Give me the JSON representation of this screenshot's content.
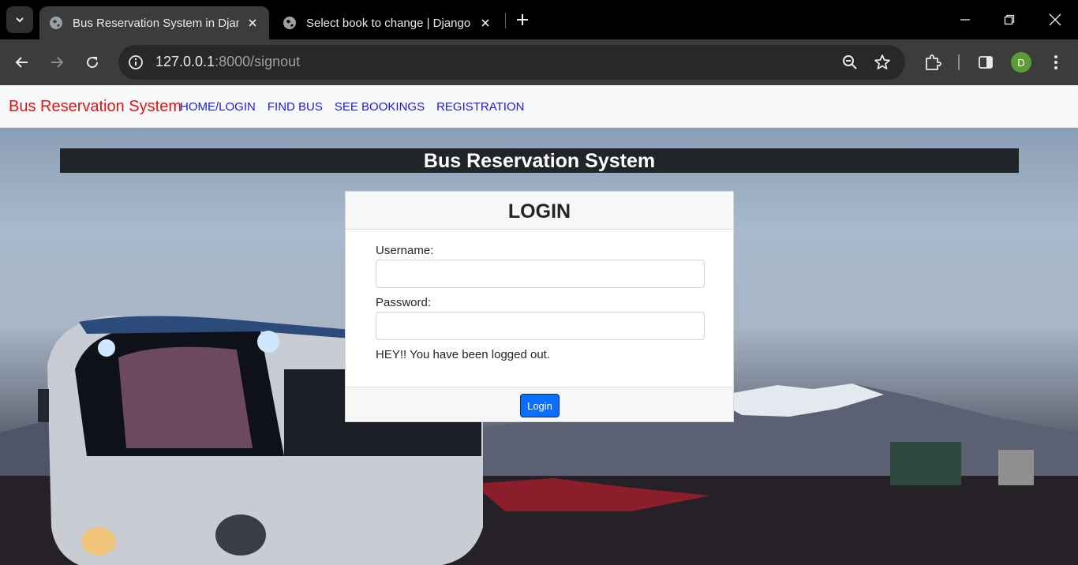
{
  "browser": {
    "tabs": [
      {
        "title": "Bus Reservation System in Djang",
        "active": true
      },
      {
        "title": "Select book to change | Django",
        "active": false
      }
    ],
    "address": {
      "host": "127.0.0.1",
      "rest": ":8000/signout"
    },
    "profile_initial": "D"
  },
  "navbar": {
    "brand": "Bus Reservation System",
    "links": [
      "HOME/LOGIN",
      "FIND BUS",
      "SEE BOOKINGS",
      "REGISTRATION"
    ]
  },
  "banner": {
    "title": "Bus Reservation System"
  },
  "login": {
    "heading": "LOGIN",
    "username_label": "Username:",
    "username_value": "",
    "password_label": "Password:",
    "password_value": "",
    "message": "HEY!! You have been logged out.",
    "button": "Login"
  },
  "colors": {
    "brand": "#dc1414",
    "link": "#1a1ad8",
    "button": "#0d6efd",
    "banner": "#212529"
  }
}
